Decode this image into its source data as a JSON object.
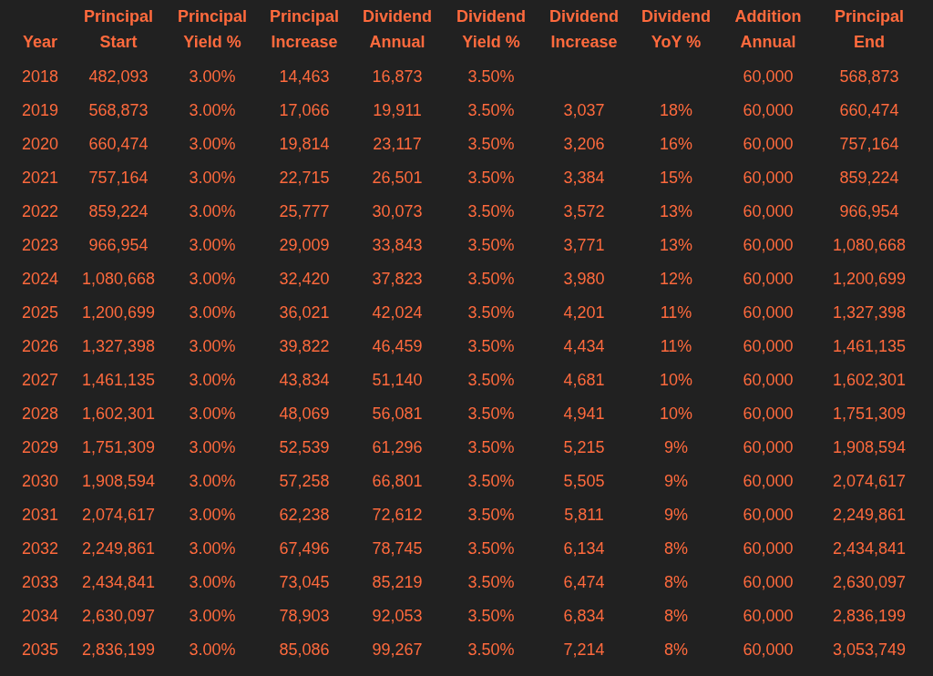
{
  "table": {
    "header_rows": [
      [
        null,
        "Principal",
        "Principal",
        "Principal",
        "Dividend",
        "Dividend",
        "Dividend",
        "Dividend",
        "Addition",
        "Principal"
      ],
      [
        "Year",
        "Start",
        "Yield %",
        "Increase",
        "Annual",
        "Yield %",
        "Increase",
        "YoY %",
        "Annual",
        "End"
      ]
    ],
    "rows": [
      [
        "2018",
        "482,093",
        "3.00%",
        "14,463",
        "16,873",
        "3.50%",
        null,
        null,
        "60,000",
        "568,873"
      ],
      [
        "2019",
        "568,873",
        "3.00%",
        "17,066",
        "19,911",
        "3.50%",
        "3,037",
        "18%",
        "60,000",
        "660,474"
      ],
      [
        "2020",
        "660,474",
        "3.00%",
        "19,814",
        "23,117",
        "3.50%",
        "3,206",
        "16%",
        "60,000",
        "757,164"
      ],
      [
        "2021",
        "757,164",
        "3.00%",
        "22,715",
        "26,501",
        "3.50%",
        "3,384",
        "15%",
        "60,000",
        "859,224"
      ],
      [
        "2022",
        "859,224",
        "3.00%",
        "25,777",
        "30,073",
        "3.50%",
        "3,572",
        "13%",
        "60,000",
        "966,954"
      ],
      [
        "2023",
        "966,954",
        "3.00%",
        "29,009",
        "33,843",
        "3.50%",
        "3,771",
        "13%",
        "60,000",
        "1,080,668"
      ],
      [
        "2024",
        "1,080,668",
        "3.00%",
        "32,420",
        "37,823",
        "3.50%",
        "3,980",
        "12%",
        "60,000",
        "1,200,699"
      ],
      [
        "2025",
        "1,200,699",
        "3.00%",
        "36,021",
        "42,024",
        "3.50%",
        "4,201",
        "11%",
        "60,000",
        "1,327,398"
      ],
      [
        "2026",
        "1,327,398",
        "3.00%",
        "39,822",
        "46,459",
        "3.50%",
        "4,434",
        "11%",
        "60,000",
        "1,461,135"
      ],
      [
        "2027",
        "1,461,135",
        "3.00%",
        "43,834",
        "51,140",
        "3.50%",
        "4,681",
        "10%",
        "60,000",
        "1,602,301"
      ],
      [
        "2028",
        "1,602,301",
        "3.00%",
        "48,069",
        "56,081",
        "3.50%",
        "4,941",
        "10%",
        "60,000",
        "1,751,309"
      ],
      [
        "2029",
        "1,751,309",
        "3.00%",
        "52,539",
        "61,296",
        "3.50%",
        "5,215",
        "9%",
        "60,000",
        "1,908,594"
      ],
      [
        "2030",
        "1,908,594",
        "3.00%",
        "57,258",
        "66,801",
        "3.50%",
        "5,505",
        "9%",
        "60,000",
        "2,074,617"
      ],
      [
        "2031",
        "2,074,617",
        "3.00%",
        "62,238",
        "72,612",
        "3.50%",
        "5,811",
        "9%",
        "60,000",
        "2,249,861"
      ],
      [
        "2032",
        "2,249,861",
        "3.00%",
        "67,496",
        "78,745",
        "3.50%",
        "6,134",
        "8%",
        "60,000",
        "2,434,841"
      ],
      [
        "2033",
        "2,434,841",
        "3.00%",
        "73,045",
        "85,219",
        "3.50%",
        "6,474",
        "8%",
        "60,000",
        "2,630,097"
      ],
      [
        "2034",
        "2,630,097",
        "3.00%",
        "78,903",
        "92,053",
        "3.50%",
        "6,834",
        "8%",
        "60,000",
        "2,836,199"
      ],
      [
        "2035",
        "2,836,199",
        "3.00%",
        "85,086",
        "99,267",
        "3.50%",
        "7,214",
        "8%",
        "60,000",
        "3,053,749"
      ]
    ]
  }
}
